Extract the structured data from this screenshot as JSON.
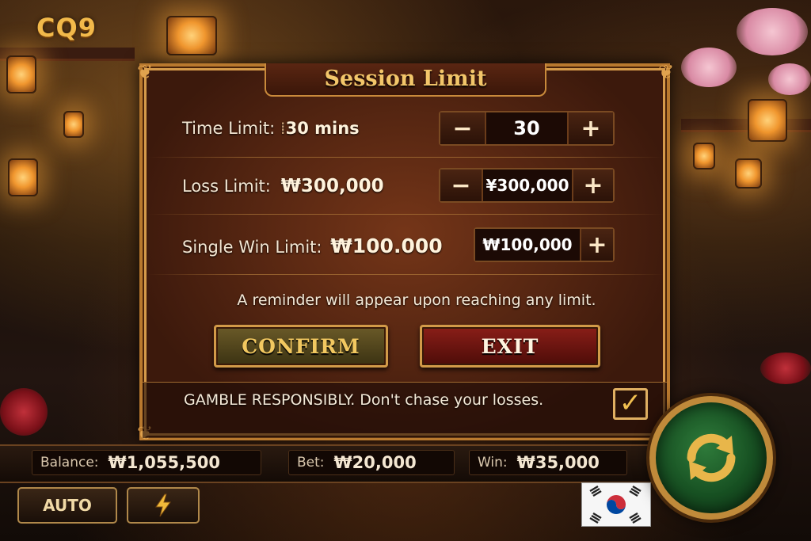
{
  "brand": {
    "logo_text": "CQ9"
  },
  "dialog": {
    "title": "Session Limit",
    "rows": [
      {
        "label": "Time Limit:",
        "value": "30 mins",
        "stepper_value": "30",
        "minus": "−",
        "plus": "+"
      },
      {
        "label": "Loss Limit:",
        "value": "₩300,000",
        "stepper_value": "¥300,000",
        "minus": "−",
        "plus": "+"
      },
      {
        "label": "Single Win Limit:",
        "value": "₩100.000",
        "stepper_value": "₩100,000",
        "plus": "+"
      }
    ],
    "reminder": "A reminder will appear upon reaching any limit.",
    "confirm_label": "CONFIRM",
    "exit_label": "EXIT",
    "gamble_text": "GAMBLE RESPONSIBLY. Don't chase your losses.",
    "gamble_checked": true,
    "check_glyph": "✓"
  },
  "status_bar": {
    "balance_label": "Balance:",
    "balance_value": "₩1,055,500",
    "bet_label": "Bet:",
    "bet_value": "₩20,000",
    "win_label": "Win:",
    "win_value": "₩35,000"
  },
  "controls": {
    "auto_label": "AUTO",
    "turbo_icon": "lightning-icon",
    "spin_icon": "refresh-arrows-icon",
    "flag_icon": "south-korea-flag-icon"
  },
  "colors": {
    "gold": "#f2c860",
    "exit_red": "#8a1e18",
    "spin_green": "#2e7a3a"
  }
}
